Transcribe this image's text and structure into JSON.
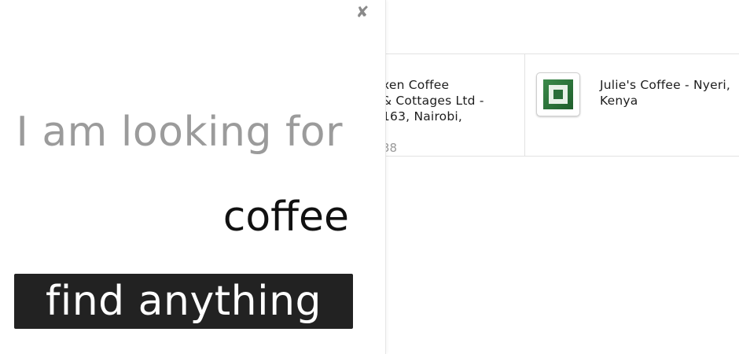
{
  "results": {
    "items": [
      {
        "title_lines": [
          "xen Coffee",
          "& Cottages Ltd -",
          "163, Nairobi,"
        ],
        "meta": "38"
      },
      {
        "title": "Julie's Coffee - Nyeri, Kenya",
        "icon": "green-square-logo-icon"
      }
    ]
  },
  "search": {
    "close_label": "✘",
    "prompt": "I am looking for",
    "query_value": "coffee",
    "button_label": "find anything"
  },
  "colors": {
    "button_bg": "#222222",
    "prompt_text": "#9b9b9b",
    "query_text": "#111111",
    "logo_green": "#2f7a3f"
  }
}
